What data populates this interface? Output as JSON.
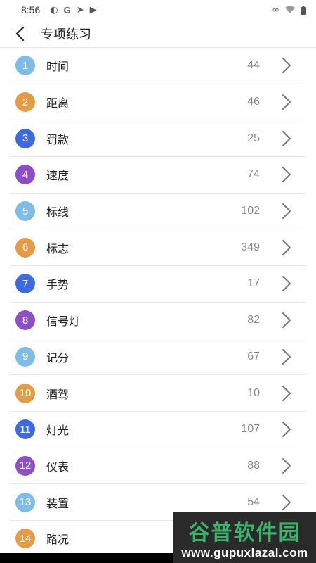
{
  "status_bar": {
    "time": "8:56",
    "left_icons": [
      "app-icon",
      "google-icon",
      "telegram-icon",
      "play-icon"
    ],
    "right_icons": [
      "link-icon",
      "wifi-icon",
      "battery-icon"
    ]
  },
  "header": {
    "title": "专项练习"
  },
  "items": [
    {
      "num": "1",
      "label": "时间",
      "count": "44",
      "color": "#7dbde8"
    },
    {
      "num": "2",
      "label": "距离",
      "count": "46",
      "color": "#e49b45"
    },
    {
      "num": "3",
      "label": "罚款",
      "count": "25",
      "color": "#3d6ae0"
    },
    {
      "num": "4",
      "label": "速度",
      "count": "74",
      "color": "#8d4fc6"
    },
    {
      "num": "5",
      "label": "标线",
      "count": "102",
      "color": "#7dbde8"
    },
    {
      "num": "6",
      "label": "标志",
      "count": "349",
      "color": "#e49b45"
    },
    {
      "num": "7",
      "label": "手势",
      "count": "17",
      "color": "#3d6ae0"
    },
    {
      "num": "8",
      "label": "信号灯",
      "count": "82",
      "color": "#8d4fc6"
    },
    {
      "num": "9",
      "label": "记分",
      "count": "67",
      "color": "#7dbde8"
    },
    {
      "num": "10",
      "label": "酒驾",
      "count": "10",
      "color": "#e49b45"
    },
    {
      "num": "11",
      "label": "灯光",
      "count": "107",
      "color": "#3d6ae0"
    },
    {
      "num": "12",
      "label": "仪表",
      "count": "88",
      "color": "#8d4fc6"
    },
    {
      "num": "13",
      "label": "装置",
      "count": "54",
      "color": "#7dbde8"
    },
    {
      "num": "14",
      "label": "路况",
      "count": "",
      "color": "#e49b45"
    }
  ],
  "watermark": {
    "title": "谷普软件园",
    "url": "www.gupuxlazal.com"
  }
}
